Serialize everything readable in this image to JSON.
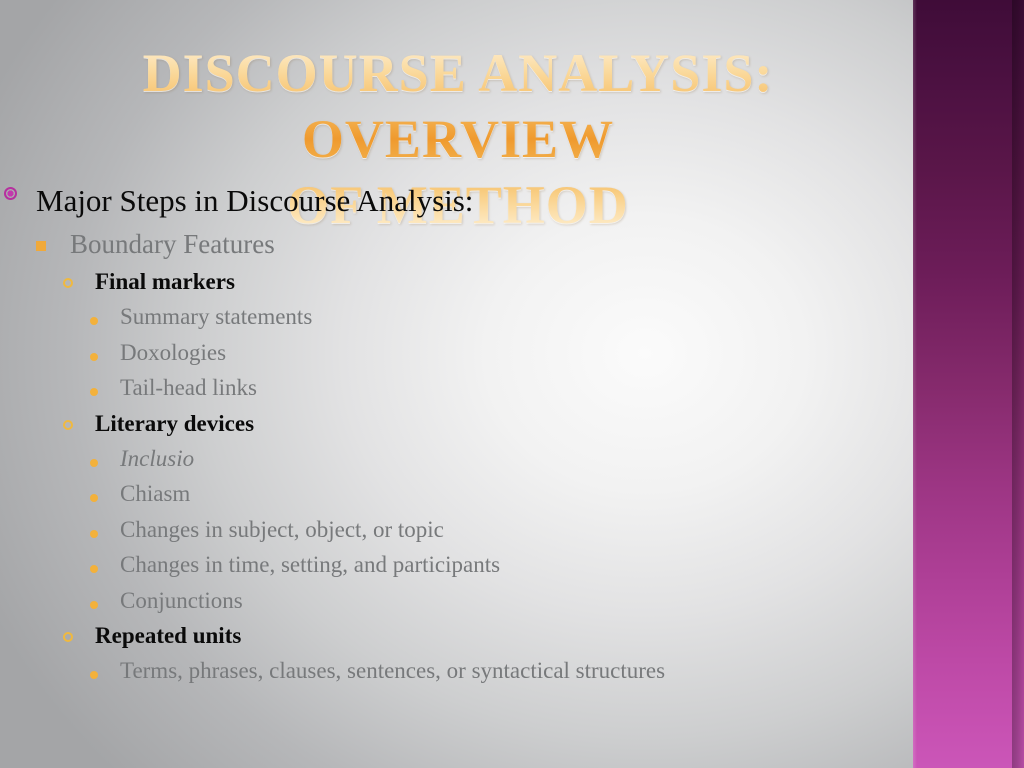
{
  "slide": {
    "title_line_1": "Discourse Analysis: Overview",
    "title_line_2": "of Method",
    "title_full": "Discourse Analysis: Overview of Method",
    "colors": {
      "title_gold_light": "#fdf0d8",
      "title_gold_mid": "#ef9a2e",
      "band_top": "#3f0c38",
      "band_bottom": "#cb56b8",
      "bullet_level1": "#b6309f",
      "bullet_level2": "#f0a93a",
      "bullet_level3": "#f0b93f",
      "bullet_level4": "#f3b13b",
      "text_dark": "#0a0a0a",
      "text_gray": "#77797b",
      "background_center": "#fbfbfb",
      "background_edge": "#a4a5a7"
    },
    "bullet_icons": {
      "level1": "ringed-dot-bullet",
      "level2": "filled-square-bullet",
      "level3": "hollow-circle-bullet",
      "level4": "filled-dot-bullet"
    },
    "outline": [
      {
        "level": 1,
        "text": "Major Steps in Discourse Analysis:",
        "style": "normal"
      },
      {
        "level": 2,
        "text": "Boundary Features",
        "style": "normal"
      },
      {
        "level": 3,
        "text": "Final markers",
        "style": "normal"
      },
      {
        "level": 4,
        "text": "Summary statements",
        "style": "normal"
      },
      {
        "level": 4,
        "text": "Doxologies",
        "style": "normal"
      },
      {
        "level": 4,
        "text": "Tail-head links",
        "style": "normal"
      },
      {
        "level": 3,
        "text": "Literary devices",
        "style": "normal"
      },
      {
        "level": 4,
        "text": "Inclusio",
        "style": "italic"
      },
      {
        "level": 4,
        "text": "Chiasm",
        "style": "normal"
      },
      {
        "level": 4,
        "text": "Changes in subject, object, or topic",
        "style": "normal"
      },
      {
        "level": 4,
        "text": "Changes in time, setting, and participants",
        "style": "normal"
      },
      {
        "level": 4,
        "text": "Conjunctions",
        "style": "normal"
      },
      {
        "level": 3,
        "text": "Repeated units",
        "style": "normal"
      },
      {
        "level": 4,
        "text": "Terms, phrases, clauses, sentences, or syntactical structures",
        "style": "normal"
      }
    ]
  }
}
